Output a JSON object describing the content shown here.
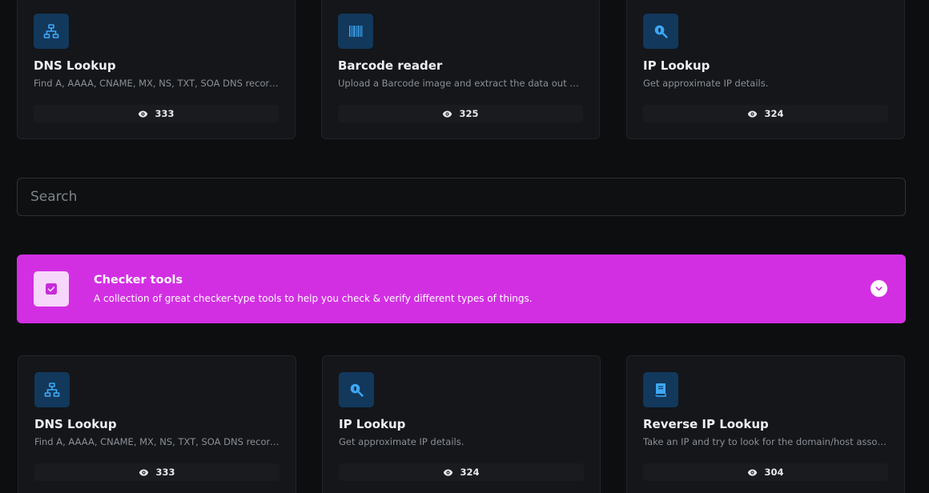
{
  "colors": {
    "background": "#0d0e10",
    "card_bg": "#141619",
    "icon_bg": "#12385c",
    "icon_fg": "#3ea8f5",
    "category_bg": "#d22fe3"
  },
  "top_cards": [
    {
      "title": "DNS Lookup",
      "description": "Find A, AAAA, CNAME, MX, NS, TXT, SOA DNS records of a host.",
      "views": "333",
      "icon": "network-icon"
    },
    {
      "title": "Barcode reader",
      "description": "Upload a Barcode image and extract the data out of it.",
      "views": "325",
      "icon": "barcode-icon"
    },
    {
      "title": "IP Lookup",
      "description": "Get approximate IP details.",
      "views": "324",
      "icon": "search-location-icon"
    }
  ],
  "search": {
    "placeholder": "Search",
    "value": ""
  },
  "category": {
    "title": "Checker tools",
    "description": "A collection of great checker-type tools to help you check & verify different types of things.",
    "icon": "checkbox-icon",
    "toggle_icon": "chevron-down-icon"
  },
  "bottom_cards": [
    {
      "title": "DNS Lookup",
      "description": "Find A, AAAA, CNAME, MX, NS, TXT, SOA DNS records of a host.",
      "views": "333",
      "icon": "network-icon"
    },
    {
      "title": "IP Lookup",
      "description": "Get approximate IP details.",
      "views": "324",
      "icon": "search-location-icon"
    },
    {
      "title": "Reverse IP Lookup",
      "description": "Take an IP and try to look for the domain/host associated with it.",
      "views": "304",
      "icon": "book-icon"
    }
  ]
}
